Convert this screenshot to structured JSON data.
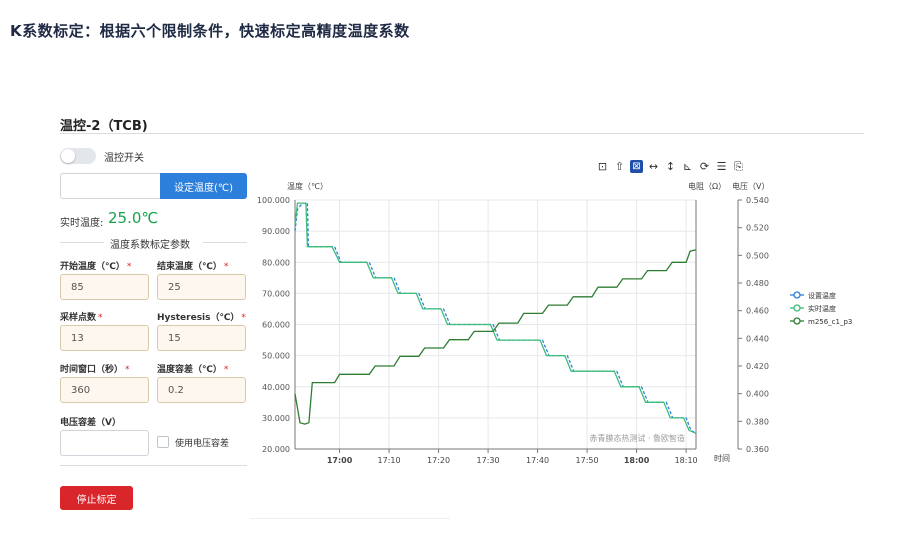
{
  "headline": "K系数标定：根据六个限制条件，快速标定高精度温度系数",
  "panel": {
    "title": "温控-2（TCB)"
  },
  "toggle": {
    "label": "温控开关",
    "on": false
  },
  "set_temp": {
    "value": "",
    "button": "设定温度(℃)"
  },
  "realtime": {
    "label": "实时温度:",
    "value": "25.0℃"
  },
  "section_title": "温度系数标定参数",
  "fields": {
    "start_temp": {
      "label": "开始温度（℃）",
      "value": "85",
      "required": true
    },
    "end_temp": {
      "label": "结束温度（℃）",
      "value": "25",
      "required": true
    },
    "sample_points": {
      "label": "采样点数",
      "value": "13",
      "required": true
    },
    "hysteresis": {
      "label": "Hysteresis（℃）",
      "value": "15",
      "required": true
    },
    "time_window": {
      "label": "时间窗口（秒）",
      "value": "360",
      "required": true
    },
    "temp_tolerance": {
      "label": "温度容差（℃）",
      "value": "0.2",
      "required": true
    },
    "voltage_tolerance": {
      "label": "电压容差（V）",
      "value": "",
      "required": false
    }
  },
  "use_voltage_tolerance": {
    "label": "使用电压容差",
    "checked": false
  },
  "stop_button": "停止标定",
  "toolbar_icons": [
    "screenshot-icon",
    "export-icon",
    "zoom-select-icon",
    "zoom-x-icon",
    "zoom-y-icon",
    "scatter-view-icon",
    "refresh-icon",
    "data-view-icon",
    "save-icon"
  ],
  "colors": {
    "primary": "#2d7fdc",
    "danger": "#d9262b",
    "realtime": "#18a34a",
    "setpoint": "#2d7fdc",
    "actual": "#3cbd7a",
    "m256": "#2e7d32"
  },
  "chart_data": {
    "type": "line",
    "left_axis_title": "温度（℃）",
    "right_axis_title_1": "电阻（Ω）",
    "right_axis_title_2": "电压（V）",
    "x_axis_title": "时间",
    "left_ylim": [
      20,
      100
    ],
    "left_ticks": [
      "100.000",
      "90.000",
      "80.000",
      "70.000",
      "60.000",
      "50.000",
      "40.000",
      "30.000",
      "20.000"
    ],
    "right_ylim": [
      0.36,
      0.54
    ],
    "right_ticks": [
      "0.540",
      "0.520",
      "0.500",
      "0.480",
      "0.460",
      "0.440",
      "0.420",
      "0.400",
      "0.380",
      "0.360"
    ],
    "x_ticks": [
      {
        "t": "17:00",
        "min": 0,
        "bold": true
      },
      {
        "t": "17:10",
        "min": 10,
        "bold": false
      },
      {
        "t": "17:20",
        "min": 20,
        "bold": false
      },
      {
        "t": "17:30",
        "min": 30,
        "bold": false
      },
      {
        "t": "17:40",
        "min": 40,
        "bold": false
      },
      {
        "t": "17:50",
        "min": 50,
        "bold": false
      },
      {
        "t": "18:00",
        "min": 60,
        "bold": true
      },
      {
        "t": "18:10",
        "min": 70,
        "bold": false
      }
    ],
    "x_range_min": [
      -9,
      72
    ],
    "watermark": "赤青膜态热测试 · 鲁欧智造",
    "grid": true,
    "legend_position": "right",
    "series": [
      {
        "name": "设置温度",
        "axis": "left",
        "style": "dashed",
        "x": [
          -9,
          -8.5,
          -7.5,
          -6.5,
          -6.3,
          -1,
          0.3,
          6,
          7.3,
          11,
          12.3,
          16,
          17.3,
          21,
          22.3,
          26,
          27.3,
          31,
          32.3,
          36,
          37.3,
          41,
          42.3,
          46,
          47.3,
          51,
          52.3,
          56,
          57.3,
          61,
          62.3,
          66,
          67.3,
          70,
          71,
          72
        ],
        "y": [
          90,
          97,
          99,
          99,
          85,
          85,
          80,
          80,
          75,
          75,
          70,
          70,
          65,
          65,
          60,
          60,
          60,
          60,
          55,
          55,
          55,
          55,
          50,
          50,
          45,
          45,
          45,
          45,
          40,
          40,
          35,
          35,
          30,
          30,
          26,
          25
        ]
      },
      {
        "name": "实时温度",
        "axis": "left",
        "style": "solid",
        "x": [
          -9,
          -8.5,
          -7.5,
          -6.8,
          -6.5,
          -1.5,
          0,
          5.5,
          6.8,
          10.5,
          11.8,
          15.5,
          16.8,
          20.5,
          21.8,
          25.5,
          26.8,
          30.5,
          31.8,
          35.5,
          36.8,
          40.5,
          41.8,
          45.5,
          46.8,
          50.5,
          51.8,
          55.5,
          56.8,
          60.5,
          61.8,
          65.5,
          66.8,
          69.5,
          70.6,
          72
        ],
        "y": [
          92,
          99,
          99,
          99,
          85,
          85,
          80,
          80,
          75,
          75,
          70,
          70,
          65,
          65,
          60,
          60,
          60,
          60,
          55,
          55,
          55,
          55,
          50,
          50,
          45,
          45,
          45,
          45,
          40,
          40,
          35,
          35,
          30,
          30,
          26,
          25
        ]
      },
      {
        "name": "m256_c1_p3",
        "axis": "right",
        "style": "solid",
        "x": [
          -9,
          -8,
          -7,
          -6.2,
          -5.5,
          -1,
          0,
          6,
          7.2,
          11,
          12.2,
          16,
          17.2,
          21,
          22.2,
          26,
          27.2,
          31,
          32.2,
          36,
          37.2,
          41,
          42.2,
          46,
          47.2,
          51,
          52.2,
          56,
          57.2,
          61,
          62.2,
          66,
          67.2,
          70,
          70.8,
          72
        ],
        "y": [
          0.4,
          0.379,
          0.378,
          0.379,
          0.408,
          0.408,
          0.414,
          0.414,
          0.42,
          0.42,
          0.427,
          0.427,
          0.433,
          0.433,
          0.439,
          0.439,
          0.445,
          0.445,
          0.451,
          0.451,
          0.458,
          0.458,
          0.464,
          0.464,
          0.47,
          0.47,
          0.477,
          0.477,
          0.483,
          0.483,
          0.489,
          0.489,
          0.495,
          0.495,
          0.503,
          0.504
        ]
      }
    ]
  }
}
